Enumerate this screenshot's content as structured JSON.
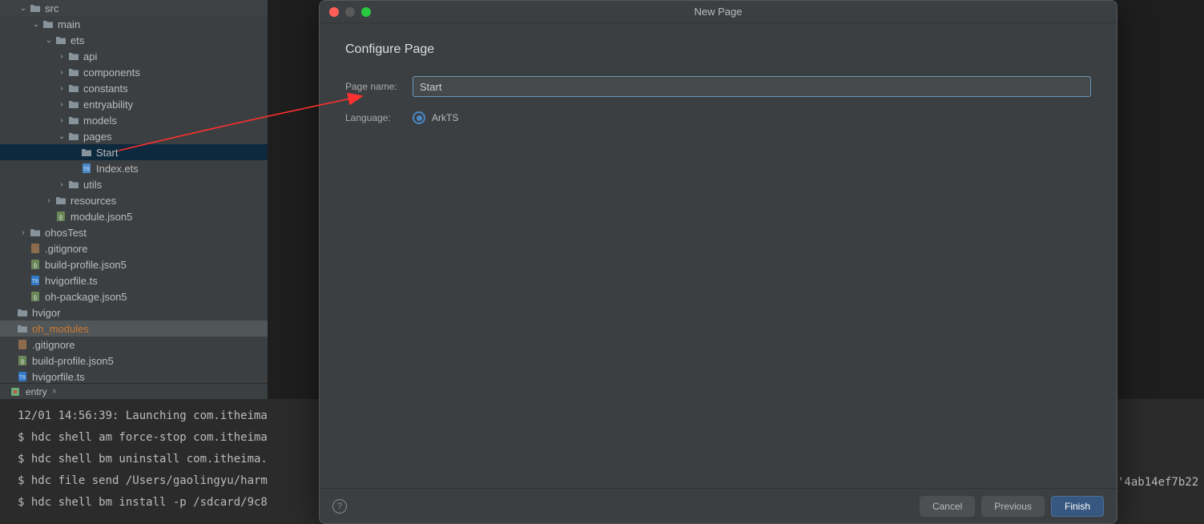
{
  "tree": {
    "rows": [
      {
        "indent": 2,
        "arrow": "v",
        "icon": "folder",
        "label": "src"
      },
      {
        "indent": 3,
        "arrow": "v",
        "icon": "folder",
        "label": "main"
      },
      {
        "indent": 4,
        "arrow": "v",
        "icon": "folder",
        "label": "ets"
      },
      {
        "indent": 5,
        "arrow": ">",
        "icon": "folder",
        "label": "api"
      },
      {
        "indent": 5,
        "arrow": ">",
        "icon": "folder",
        "label": "components"
      },
      {
        "indent": 5,
        "arrow": ">",
        "icon": "folder",
        "label": "constants"
      },
      {
        "indent": 5,
        "arrow": ">",
        "icon": "folder",
        "label": "entryability"
      },
      {
        "indent": 5,
        "arrow": ">",
        "icon": "folder",
        "label": "models"
      },
      {
        "indent": 5,
        "arrow": "v",
        "icon": "folder",
        "label": "pages"
      },
      {
        "indent": 6,
        "arrow": "",
        "icon": "folder",
        "label": "Start",
        "selected": true
      },
      {
        "indent": 6,
        "arrow": "",
        "icon": "file-ets",
        "label": "Index.ets"
      },
      {
        "indent": 5,
        "arrow": ">",
        "icon": "folder",
        "label": "utils"
      },
      {
        "indent": 4,
        "arrow": ">",
        "icon": "folder",
        "label": "resources"
      },
      {
        "indent": 4,
        "arrow": "",
        "icon": "file-json",
        "label": "module.json5"
      },
      {
        "indent": 2,
        "arrow": ">",
        "icon": "folder",
        "label": "ohosTest"
      },
      {
        "indent": 2,
        "arrow": "",
        "icon": "file-git",
        "label": ".gitignore"
      },
      {
        "indent": 2,
        "arrow": "",
        "icon": "file-json",
        "label": "build-profile.json5"
      },
      {
        "indent": 2,
        "arrow": "",
        "icon": "file-ts",
        "label": "hvigorfile.ts"
      },
      {
        "indent": 2,
        "arrow": "",
        "icon": "file-json",
        "label": "oh-package.json5"
      },
      {
        "indent": 1,
        "arrow": "",
        "icon": "folder",
        "label": "hvigor"
      },
      {
        "indent": 1,
        "arrow": "",
        "icon": "folder",
        "label": "oh_modules",
        "highlighted": true,
        "labelColor": "orange"
      },
      {
        "indent": 1,
        "arrow": "",
        "icon": "file-git",
        "label": ".gitignore"
      },
      {
        "indent": 1,
        "arrow": "",
        "icon": "file-json",
        "label": "build-profile.json5"
      },
      {
        "indent": 1,
        "arrow": "",
        "icon": "file-ts",
        "label": "hvigorfile.ts"
      }
    ]
  },
  "tab": {
    "label": "entry"
  },
  "console": {
    "lines": [
      "12/01 14:56:39: Launching com.itheima",
      "$ hdc shell am force-stop com.itheima",
      "$ hdc shell bm uninstall com.itheima.",
      "$ hdc file send /Users/gaolingyu/harm",
      "$ hdc shell bm install -p /sdcard/9c8"
    ],
    "rightFragment": "'4ab14ef7b22"
  },
  "dialog": {
    "title": "New Page",
    "heading": "Configure Page",
    "pageNameLabel": "Page name:",
    "pageNameValue": "Start",
    "languageLabel": "Language:",
    "languageOption": "ArkTS",
    "cancel": "Cancel",
    "previous": "Previous",
    "finish": "Finish"
  }
}
